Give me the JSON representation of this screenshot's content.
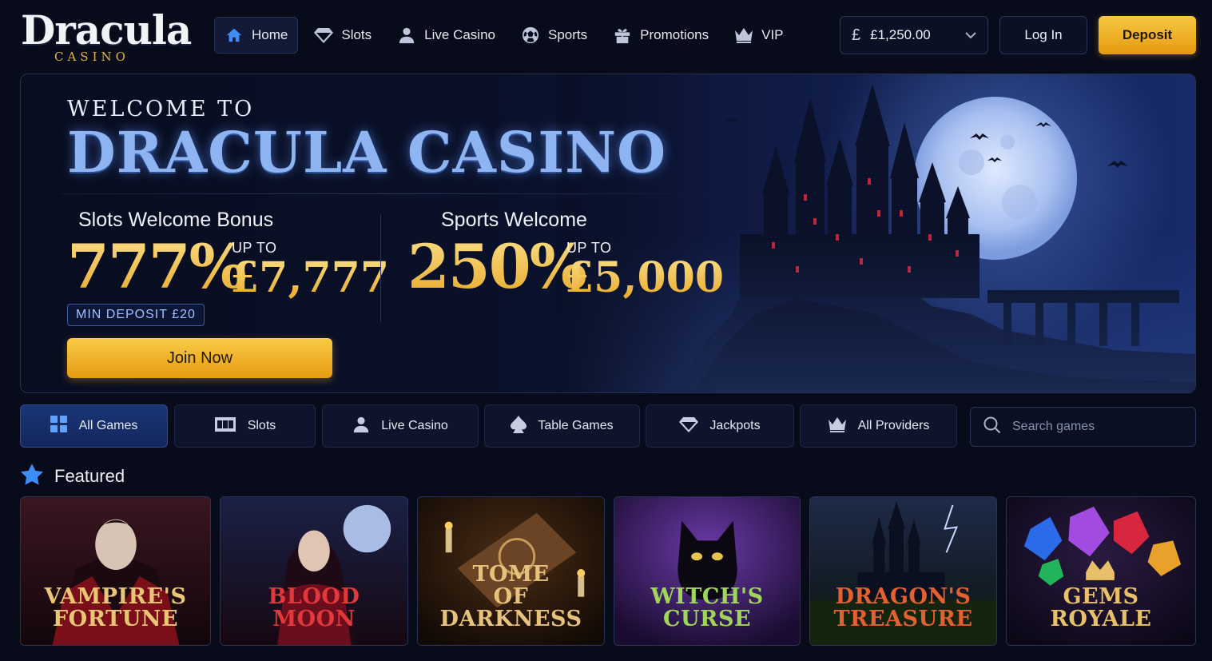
{
  "brand": {
    "name": "Dracula",
    "sub": "CASINO"
  },
  "nav": [
    {
      "label": "Home",
      "icon": "home-icon",
      "active": true
    },
    {
      "label": "Slots",
      "icon": "diamond-icon"
    },
    {
      "label": "Live Casino",
      "icon": "person-icon"
    },
    {
      "label": "Sports",
      "icon": "soccer-ball-icon"
    },
    {
      "label": "Promotions",
      "icon": "gift-icon"
    },
    {
      "label": "VIP",
      "icon": "crown-icon"
    }
  ],
  "account": {
    "currency_symbol": "£",
    "balance": "£1,250.00",
    "login_label": "Log In",
    "deposit_label": "Deposit"
  },
  "hero": {
    "welcome_to": "WELCOME TO",
    "title": "DRACULA CASINO",
    "slots": {
      "label": "Slots Welcome Bonus",
      "percent": "777%",
      "up_to": "UP TO",
      "amount": "£7,777"
    },
    "sports": {
      "label": "Sports Welcome",
      "percent": "250%",
      "up_to": "UP TO",
      "amount": "£5,000"
    },
    "min_deposit": "MIN DEPOSIT £20",
    "cta": "Join Now"
  },
  "tabs": [
    {
      "label": "All Games",
      "icon": "grid-icon",
      "active": true
    },
    {
      "label": "Slots",
      "icon": "slot-machine-icon"
    },
    {
      "label": "Live Casino",
      "icon": "person-icon"
    },
    {
      "label": "Table Games",
      "icon": "spade-icon"
    },
    {
      "label": "Jackpots",
      "icon": "diamond-icon"
    },
    {
      "label": "All Providers",
      "icon": "crown-icon"
    }
  ],
  "search": {
    "placeholder": "Search games"
  },
  "featured": {
    "title": "Featured",
    "games": [
      {
        "title": "VAMPIRE'S FORTUNE",
        "color": "#e9c576"
      },
      {
        "title": "BLOOD MOON",
        "color": "#e2373b"
      },
      {
        "title": "TOME OF DARKNESS",
        "color": "#e6c27d"
      },
      {
        "title": "WITCH'S CURSE",
        "color": "#9fd65a"
      },
      {
        "title": "DRAGON'S TREASURE",
        "color": "#e5602f"
      },
      {
        "title": "GEMS ROYALE",
        "color": "#e8c06a"
      }
    ]
  },
  "colors": {
    "accent": "#3f8ef7",
    "gold": "#f3c04a",
    "background": "#070b1a"
  }
}
